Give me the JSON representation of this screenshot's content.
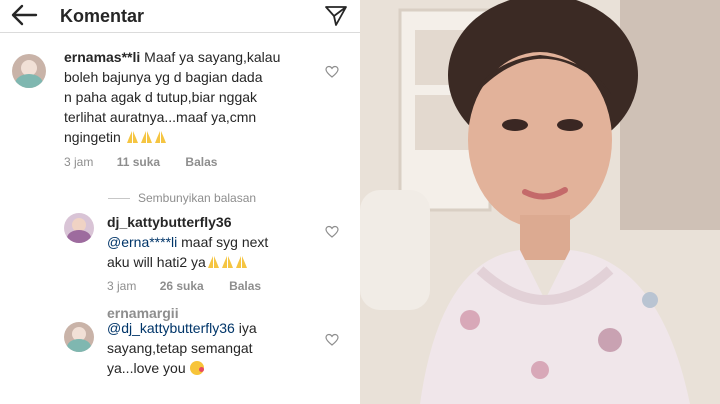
{
  "header": {
    "title": "Komentar"
  },
  "comments": [
    {
      "username": "ernamas**li",
      "text_line1": "Maaf ya sayang,kalau",
      "text_line2": "boleh bajunya yg d bagian dada",
      "text_line3": "n paha agak d tutup,biar nggak",
      "text_line4": "terlihat auratnya...maaf ya,cmn",
      "text_line5": "ngingetin",
      "time": "3 jam",
      "likes": "11 suka",
      "reply": "Balas"
    }
  ],
  "replies_toggle": "Sembunyikan balasan",
  "replies": [
    {
      "username": "dj_kattybutterfly36",
      "mention": "@erna****li",
      "text_line1": "maaf syg next",
      "text_line2": "aku will hati2 ya",
      "time": "3 jam",
      "likes": "26 suka",
      "reply": "Balas"
    },
    {
      "username": "ernamargii",
      "mention": "@dj_kattybutterfly36",
      "text_line1": "iya",
      "text_line2": "sayang,tetap semangat",
      "text_line3": "ya...love you"
    }
  ],
  "icons": {
    "back": "arrow-left-icon",
    "send": "paper-plane-icon",
    "like": "heart-outline-icon",
    "pray": "folded-hands-emoji",
    "kiss": "kissing-face-emoji"
  },
  "colors": {
    "text": "#262626",
    "muted": "#8e8e8e",
    "mention": "#003569",
    "divider": "#dbdbdb"
  }
}
